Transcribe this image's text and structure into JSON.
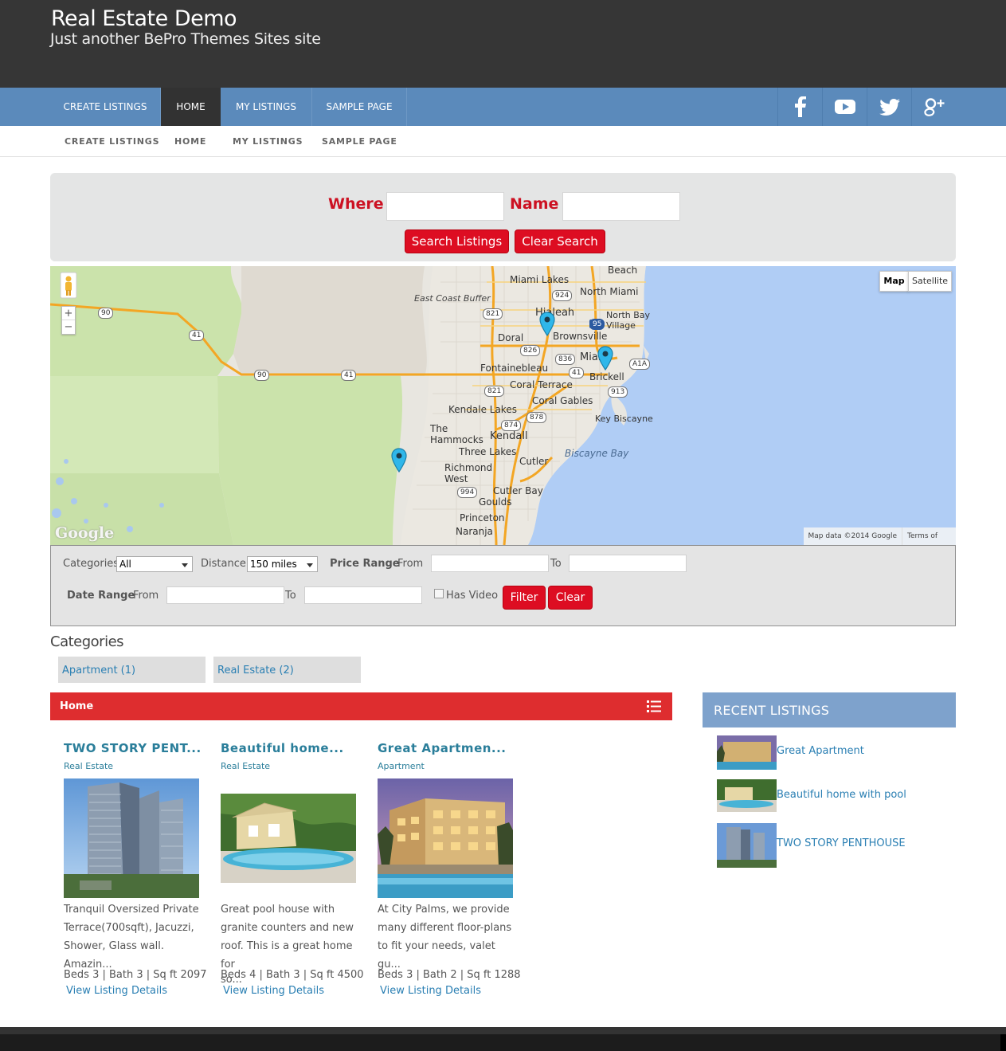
{
  "site": {
    "title": "Real Estate Demo",
    "tagline": "Just another BePro Themes Sites site"
  },
  "primary_nav": {
    "items": [
      {
        "label": "CREATE LISTINGS",
        "active": false
      },
      {
        "label": "HOME",
        "active": true
      },
      {
        "label": "MY LISTINGS",
        "active": false
      },
      {
        "label": "SAMPLE PAGE",
        "active": false
      }
    ],
    "social": [
      "facebook-icon",
      "youtube-icon",
      "twitter-icon",
      "google-plus-icon"
    ]
  },
  "secondary_nav": {
    "items": [
      "CREATE LISTINGS",
      "HOME",
      "MY LISTINGS",
      "SAMPLE PAGE"
    ]
  },
  "search": {
    "where_label": "Where",
    "where_value": "",
    "name_label": "Name",
    "name_value": "",
    "search_button": "Search Listings",
    "clear_button": "Clear Search"
  },
  "map": {
    "type_map": "Map",
    "type_satellite": "Satellite",
    "zoom_in": "+",
    "zoom_out": "−",
    "google_logo": "Google",
    "attribution": "Map data ©2014 Google",
    "terms": "Terms of Use",
    "labels": [
      "Beach",
      "Miami Lakes",
      "East Coast Buffer",
      "North Miami",
      "Hialeah",
      "North Bay Village",
      "Doral",
      "Brownsville",
      "Miami",
      "Fontainebleau",
      "Brickell",
      "Coral Terrace",
      "Coral Gables",
      "Kendale Lakes",
      "Key Biscayne",
      "The Hammocks",
      "Kendall",
      "Three Lakes",
      "Biscayne Bay",
      "Cutler",
      "Richmond West",
      "Cutler Bay",
      "Goulds",
      "Princeton",
      "Naranja"
    ],
    "road_shields": [
      "90",
      "41",
      "90",
      "41",
      "924",
      "821",
      "95",
      "826",
      "836",
      "41",
      "A1A",
      "821",
      "913",
      "878",
      "874",
      "994"
    ],
    "colors": {
      "water": "#b0cdf5",
      "land": "#e8e6e0",
      "park": "#cbe3ab",
      "highway": "#f3a624"
    }
  },
  "filter": {
    "categories_label": "Categories",
    "categories_value": "All",
    "distance_label": "Distance:",
    "distance_value": "150 miles",
    "price_range_label": "Price Range",
    "from_label": "From",
    "to_label": "To",
    "date_range_label": "Date Range",
    "has_video_label": "Has Video",
    "has_video_checked": false,
    "filter_button": "Filter",
    "clear_button": "Clear"
  },
  "categories": {
    "heading": "Categories",
    "items": [
      "Apartment (1)",
      "Real Estate (2)"
    ]
  },
  "listings": {
    "bar_title": "Home",
    "cards": [
      {
        "title": "TWO STORY PENT...",
        "category": "Real Estate",
        "desc_lines": [
          "Tranquil Oversized Private",
          "Terrace(700sqft), Jacuzzi,",
          "Shower, Glass wall. Amazin..."
        ],
        "stats": "Beds 3 | Bath 3 | Sq ft 2097",
        "link": "View Listing Details"
      },
      {
        "title": "Beautiful home...",
        "category": "Real Estate",
        "desc_lines": [
          "Great pool house with",
          "granite counters and new",
          "roof. This is a great home for",
          "so..."
        ],
        "stats": "Beds 4 | Bath 3 | Sq ft 4500",
        "link": "View Listing Details"
      },
      {
        "title": "Great Apartmen...",
        "category": "Apartment",
        "desc_lines": [
          "At City Palms, we provide",
          "many different floor-plans",
          "to fit your needs, valet gu..."
        ],
        "stats": "Beds 3 | Bath 2 | Sq ft 1288",
        "link": "View Listing Details"
      }
    ]
  },
  "sidebar": {
    "heading": "RECENT LISTINGS",
    "items": [
      "Great Apartment",
      "Beautiful home with pool",
      "TWO STORY PENTHOUSE"
    ]
  }
}
